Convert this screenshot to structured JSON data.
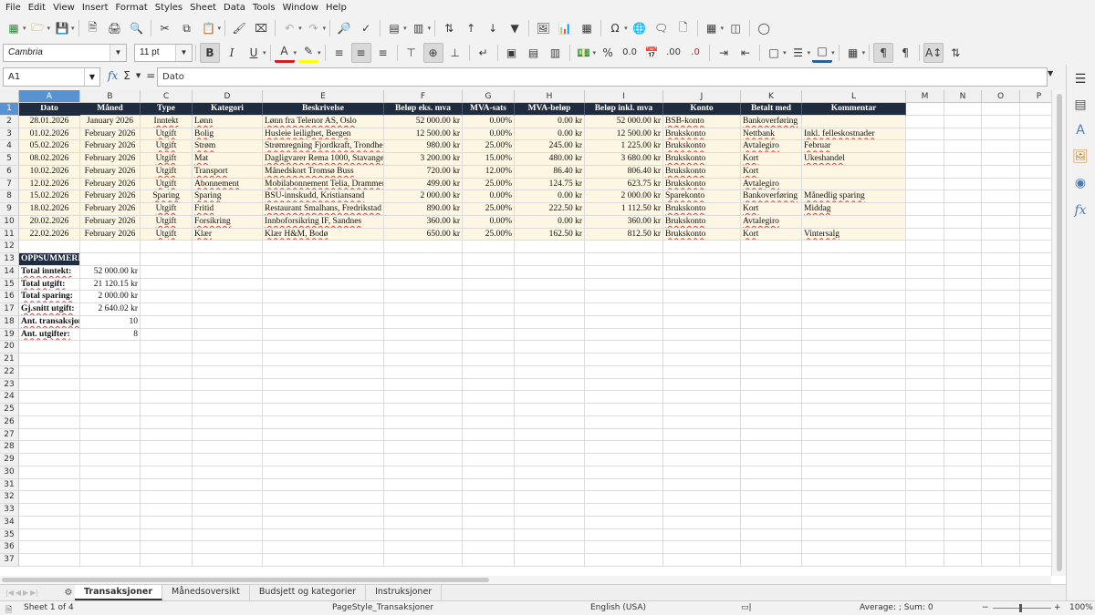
{
  "menu": [
    "File",
    "Edit",
    "View",
    "Insert",
    "Format",
    "Styles",
    "Sheet",
    "Data",
    "Tools",
    "Window",
    "Help"
  ],
  "font": {
    "name": "Cambria",
    "size": "11 pt"
  },
  "formula": {
    "cell_ref": "A1",
    "content": "Dato"
  },
  "columns": [
    "A",
    "B",
    "C",
    "D",
    "E",
    "F",
    "G",
    "H",
    "I",
    "J",
    "K",
    "L",
    "M",
    "N",
    "O",
    "P"
  ],
  "headers": [
    "Dato",
    "Måned",
    "Type",
    "Kategori",
    "Beskrivelse",
    "Beløp eks. mva",
    "MVA-sats",
    "MVA-beløp",
    "Beløp inkl. mva",
    "Konto",
    "Betalt med",
    "Kommentar"
  ],
  "rows": [
    [
      "28.01.2026",
      "January 2026",
      "Inntekt",
      "Lønn",
      "Lønn fra Telenor AS, Oslo",
      "52 000.00 kr",
      "0.00%",
      "0.00 kr",
      "52 000.00 kr",
      "BSB-konto",
      "Bankoverføring",
      ""
    ],
    [
      "01.02.2026",
      "February 2026",
      "Utgift",
      "Bolig",
      "Husleie leilighet, Bergen",
      "12 500.00 kr",
      "0.00%",
      "0.00 kr",
      "12 500.00 kr",
      "Brukskonto",
      "Nettbank",
      "Inkl. felleskostnader"
    ],
    [
      "05.02.2026",
      "February 2026",
      "Utgift",
      "Strøm",
      "Strømregning Fjordkraft, Trondheim",
      "980.00 kr",
      "25.00%",
      "245.00 kr",
      "1 225.00 kr",
      "Brukskonto",
      "Avtalegiro",
      "Februar"
    ],
    [
      "08.02.2026",
      "February 2026",
      "Utgift",
      "Mat",
      "Dagligvarer Rema 1000, Stavanger",
      "3 200.00 kr",
      "15.00%",
      "480.00 kr",
      "3 680.00 kr",
      "Brukskonto",
      "Kort",
      "Ukeshandel"
    ],
    [
      "10.02.2026",
      "February 2026",
      "Utgift",
      "Transport",
      "Månedskort Tromsø Buss",
      "720.00 kr",
      "12.00%",
      "86.40 kr",
      "806.40 kr",
      "Brukskonto",
      "Kort",
      ""
    ],
    [
      "12.02.2026",
      "February 2026",
      "Utgift",
      "Abonnement",
      "Mobilabonnement Telia, Drammen",
      "499.00 kr",
      "25.00%",
      "124.75 kr",
      "623.75 kr",
      "Brukskonto",
      "Avtalegiro",
      ""
    ],
    [
      "15.02.2026",
      "February 2026",
      "Sparing",
      "Sparing",
      "BSU-innskudd, Kristiansand",
      "2 000.00 kr",
      "0.00%",
      "0.00 kr",
      "2 000.00 kr",
      "Sparekonto",
      "Bankoverføring",
      "Månedlig sparing"
    ],
    [
      "18.02.2026",
      "February 2026",
      "Utgift",
      "Fritid",
      "Restaurant Smalhans, Fredrikstad",
      "890.00 kr",
      "25.00%",
      "222.50 kr",
      "1 112.50 kr",
      "Brukskonto",
      "Kort",
      "Middag"
    ],
    [
      "20.02.2026",
      "February 2026",
      "Utgift",
      "Forsikring",
      "Innboforsikring IF, Sandnes",
      "360.00 kr",
      "0.00%",
      "0.00 kr",
      "360.00 kr",
      "Brukskonto",
      "Avtalegiro",
      ""
    ],
    [
      "22.02.2026",
      "February 2026",
      "Utgift",
      "Klær",
      "Klær H&M, Bodø",
      "650.00 kr",
      "25.00%",
      "162.50 kr",
      "812.50 kr",
      "Brukskonto",
      "Kort",
      "Vintersalg"
    ]
  ],
  "summary": {
    "title": "OPPSUMMERING",
    "items": [
      {
        "label": "Total inntekt:",
        "value": "52 000.00 kr"
      },
      {
        "label": "Total utgift:",
        "value": "21 120.15 kr"
      },
      {
        "label": "Total sparing:",
        "value": "2 000.00 kr"
      },
      {
        "label": "Gj.snitt utgift:",
        "value": "2 640.02 kr"
      },
      {
        "label": "Ant. transaksjoner:",
        "value": "10"
      },
      {
        "label": "Ant. utgifter:",
        "value": "8"
      }
    ]
  },
  "sheet_tabs": [
    "Transaksjoner",
    "Månedsoversikt",
    "Budsjett og kategorier",
    "Instruksjoner"
  ],
  "active_tab": "Transaksjoner",
  "status": {
    "sheet": "Sheet 1 of 4",
    "page_style": "PageStyle_Transaksjoner",
    "language": "English (USA)",
    "calc": "Average: ; Sum: 0",
    "zoom": "100%"
  },
  "colors": {
    "header_bg": "#1f2b3e",
    "data_bg": "#fdf6e2",
    "selection": "#5793d3"
  }
}
